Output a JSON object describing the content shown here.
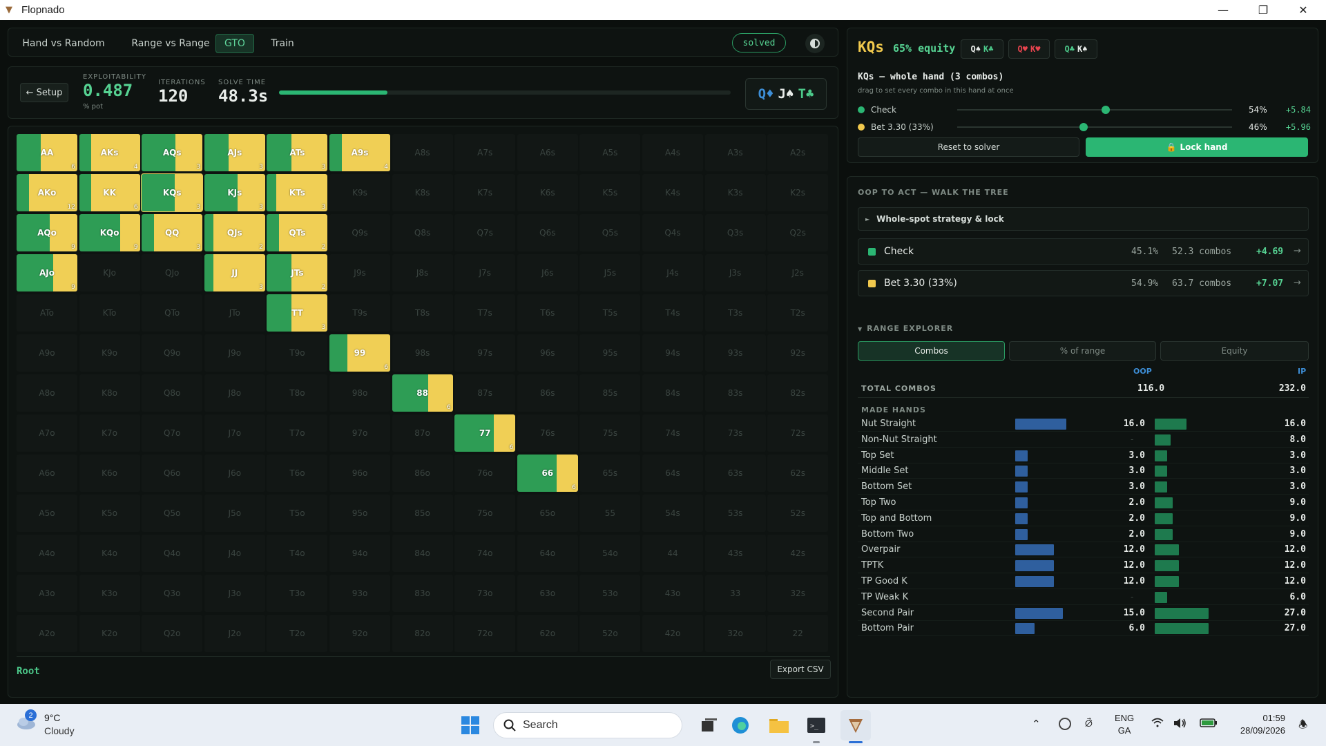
{
  "window": {
    "title": "Flopnado"
  },
  "nav": {
    "tabs": [
      "Hand vs Random",
      "Range vs Range",
      "GTO",
      "Train"
    ],
    "active_tab": "GTO",
    "status_badge": "solved"
  },
  "stats": {
    "setup_label": "← Setup",
    "exploitability_label": "EXPLOITABILITY",
    "exploitability_value": "0.487",
    "exploitability_unit": "% pot",
    "iterations_label": "ITERATIONS",
    "iterations_value": "120",
    "solve_time_label": "SOLVE TIME",
    "solve_time_value": "48.3s",
    "progress_fraction": 0.24,
    "board": [
      {
        "rank": "Q",
        "suit": "♦",
        "color": "#3d8ed6"
      },
      {
        "rank": "J",
        "suit": "♠",
        "color": "#e8ece9"
      },
      {
        "rank": "T",
        "suit": "♣",
        "color": "#4cc98a"
      }
    ]
  },
  "grid": {
    "ranks": [
      "A",
      "K",
      "Q",
      "J",
      "T",
      "9",
      "8",
      "7",
      "6",
      "5",
      "4",
      "3",
      "2"
    ],
    "active_cells": [
      {
        "label": "AA",
        "count": "6",
        "check": 0.4
      },
      {
        "label": "AKs",
        "count": "4",
        "check": 0.2
      },
      {
        "label": "AQs",
        "count": "3",
        "check": 0.55
      },
      {
        "label": "AJs",
        "count": "3",
        "check": 0.4
      },
      {
        "label": "ATs",
        "count": "3",
        "check": 0.4
      },
      {
        "label": "A9s",
        "count": "4",
        "check": 0.2
      },
      {
        "label": "AKo",
        "count": "12",
        "check": 0.2
      },
      {
        "label": "KK",
        "count": "6",
        "check": 0.2
      },
      {
        "label": "KQs",
        "count": "3",
        "check": 0.54,
        "selected": true
      },
      {
        "label": "KJs",
        "count": "3",
        "check": 0.55
      },
      {
        "label": "KTs",
        "count": "3",
        "check": 0.15
      },
      {
        "label": "AQo",
        "count": "9",
        "check": 0.55
      },
      {
        "label": "KQo",
        "count": "9",
        "check": 0.68
      },
      {
        "label": "QQ",
        "count": "3",
        "check": 0.2
      },
      {
        "label": "QJs",
        "count": "2",
        "check": 0.15
      },
      {
        "label": "QTs",
        "count": "2",
        "check": 0.2
      },
      {
        "label": "AJo",
        "count": "9",
        "check": 0.6
      },
      {
        "label": "JJ",
        "count": "3",
        "check": 0.15
      },
      {
        "label": "JTs",
        "count": "2",
        "check": 0.4
      },
      {
        "label": "TT",
        "count": "3",
        "check": 0.4
      },
      {
        "label": "99",
        "count": "6",
        "check": 0.3
      },
      {
        "label": "88",
        "count": "6",
        "check": 0.6
      },
      {
        "label": "77",
        "count": "6",
        "check": 0.65
      },
      {
        "label": "66",
        "count": "6",
        "check": 0.65
      }
    ],
    "root_label": "Root",
    "export_label": "Export CSV"
  },
  "hand": {
    "name": "KQs",
    "equity": "65% equity",
    "combos": [
      {
        "a": "Q♠",
        "ac": "#e8ece9",
        "b": "K♣",
        "bc": "#4cc98a"
      },
      {
        "a": "Q♥",
        "ac": "#e8444e",
        "b": "K♥",
        "bc": "#e8444e"
      },
      {
        "a": "Q♣",
        "ac": "#4cc98a",
        "b": "K♠",
        "bc": "#e8ece9"
      }
    ],
    "subtitle": "KQs — whole hand (3 combos)",
    "hint": "drag to set every combo in this hand at once",
    "actions": [
      {
        "name": "Check",
        "pct": "54%",
        "ev": "+5.84",
        "value": 0.54,
        "color": "#2bb673"
      },
      {
        "name": "Bet 3.30 (33%)",
        "pct": "46%",
        "ev": "+5.96",
        "value": 0.46,
        "color": "#f1c94d"
      }
    ],
    "reset_label": "Reset to solver",
    "lock_label": "Lock hand"
  },
  "tree": {
    "heading": "OOP TO ACT — WALK THE TREE",
    "spot_label": "Whole-spot strategy & lock",
    "strategies": [
      {
        "name": "Check",
        "freq": "45.1%",
        "combos": "52.3 combos",
        "ev": "+4.69",
        "color": "#2bb673"
      },
      {
        "name": "Bet 3.30 (33%)",
        "freq": "54.9%",
        "combos": "63.7 combos",
        "ev": "+7.07",
        "color": "#f1c94d"
      }
    ]
  },
  "range_explorer": {
    "heading": "RANGE EXPLORER",
    "tabs": [
      "Combos",
      "% of range",
      "Equity"
    ],
    "active_tab": "Combos",
    "col_oop": "OOP",
    "col_ip": "IP",
    "total_label": "TOTAL COMBOS",
    "total_oop": "116.0",
    "total_ip": "232.0",
    "made_hands_label": "MADE HANDS",
    "max_value": 27,
    "rows": [
      {
        "name": "Nut Straight",
        "oop": 16.0,
        "oop_text": "16.0",
        "ip": 16.0,
        "ip_text": "16.0"
      },
      {
        "name": "Non-Nut Straight",
        "oop": 0,
        "oop_text": "",
        "ip": 8.0,
        "ip_text": "8.0"
      },
      {
        "name": "Top Set",
        "oop": 3.0,
        "oop_text": "3.0",
        "ip": 3.0,
        "ip_text": "3.0"
      },
      {
        "name": "Middle Set",
        "oop": 3.0,
        "oop_text": "3.0",
        "ip": 3.0,
        "ip_text": "3.0"
      },
      {
        "name": "Bottom Set",
        "oop": 3.0,
        "oop_text": "3.0",
        "ip": 3.0,
        "ip_text": "3.0"
      },
      {
        "name": "Top Two",
        "oop": 2.0,
        "oop_text": "2.0",
        "ip": 9.0,
        "ip_text": "9.0"
      },
      {
        "name": "Top and Bottom",
        "oop": 2.0,
        "oop_text": "2.0",
        "ip": 9.0,
        "ip_text": "9.0"
      },
      {
        "name": "Bottom Two",
        "oop": 2.0,
        "oop_text": "2.0",
        "ip": 9.0,
        "ip_text": "9.0"
      },
      {
        "name": "Overpair",
        "oop": 12.0,
        "oop_text": "12.0",
        "ip": 12.0,
        "ip_text": "12.0"
      },
      {
        "name": "TPTK",
        "oop": 12.0,
        "oop_text": "12.0",
        "ip": 12.0,
        "ip_text": "12.0"
      },
      {
        "name": "TP Good K",
        "oop": 12.0,
        "oop_text": "12.0",
        "ip": 12.0,
        "ip_text": "12.0"
      },
      {
        "name": "TP Weak K",
        "oop": 0,
        "oop_text": "",
        "ip": 6.0,
        "ip_text": "6.0"
      },
      {
        "name": "Second Pair",
        "oop": 15.0,
        "oop_text": "15.0",
        "ip": 27.0,
        "ip_text": "27.0"
      },
      {
        "name": "Bottom Pair",
        "oop": 6.0,
        "oop_text": "6.0",
        "ip": 27.0,
        "ip_text": "27.0"
      }
    ]
  },
  "taskbar": {
    "weather_temp": "9°C",
    "weather_cond": "Cloudy",
    "weather_badge": "2",
    "search_placeholder": "Search",
    "lang_1": "ENG",
    "lang_2": "GA",
    "time": "01:59",
    "date": "28/09/2026"
  }
}
